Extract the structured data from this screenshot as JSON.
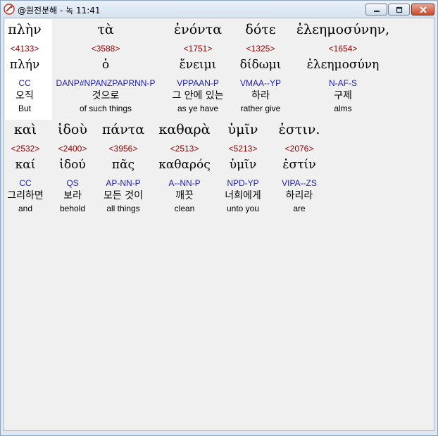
{
  "window": {
    "title": "@원전분해 - 녹 11:41"
  },
  "rows": [
    {
      "words": [
        {
          "greek": "πλὴν",
          "strong": "<4133>",
          "lemma": "πλήν",
          "morph": "CC",
          "korean": "오직",
          "english": "But"
        },
        {
          "greek": "τὰ",
          "strong": "<3588>",
          "lemma": "ὁ",
          "morph": "DANP#NPANZPAPRNN-P",
          "korean": "것으로",
          "english": "of such things"
        },
        {
          "greek": "ἐνόντα",
          "strong": "<1751>",
          "lemma": "ἔνειμι",
          "morph": "VPPAAN-P",
          "korean": "그 안에 있는",
          "english": "as ye have"
        },
        {
          "greek": "δότε",
          "strong": "<1325>",
          "lemma": "δίδωμι",
          "morph": "VMAA--YP",
          "korean": "하라",
          "english": "rather give"
        },
        {
          "greek": "ἐλεημοσύνην,",
          "strong": "<1654>",
          "lemma": "ἐλεημοσύνη",
          "morph": "N-AF-S",
          "korean": "구제",
          "english": "alms"
        }
      ]
    },
    {
      "words": [
        {
          "greek": "καὶ",
          "strong": "<2532>",
          "lemma": "καί",
          "morph": "CC",
          "korean": "그리하면",
          "english": "and"
        },
        {
          "greek": "ἰδοὺ",
          "strong": "<2400>",
          "lemma": "ἰδού",
          "morph": "QS",
          "korean": "보라",
          "english": "behold"
        },
        {
          "greek": "πάντα",
          "strong": "<3956>",
          "lemma": "πᾶς",
          "morph": "AP-NN-P",
          "korean": "모든 것이",
          "english": "all things"
        },
        {
          "greek": "καθαρὰ",
          "strong": "<2513>",
          "lemma": "καθαρός",
          "morph": "A--NN-P",
          "korean": "깨끗",
          "english": "clean"
        },
        {
          "greek": "ὑμῖν",
          "strong": "<5213>",
          "lemma": "ὑμῖν",
          "morph": "NPD-YP",
          "korean": "너희에게",
          "english": "unto you"
        },
        {
          "greek": "ἐστιν.",
          "strong": "<2076>",
          "lemma": "ἐστίν",
          "morph": "VIPA--ZS",
          "korean": "하리라",
          "english": "are"
        }
      ]
    }
  ],
  "colors": {
    "strong": "#8b0000",
    "morph": "#1f1fb4"
  },
  "icons": {
    "app": "bible-app-icon",
    "minimize": "minimize-icon",
    "maximize": "maximize-icon",
    "close": "close-icon"
  }
}
